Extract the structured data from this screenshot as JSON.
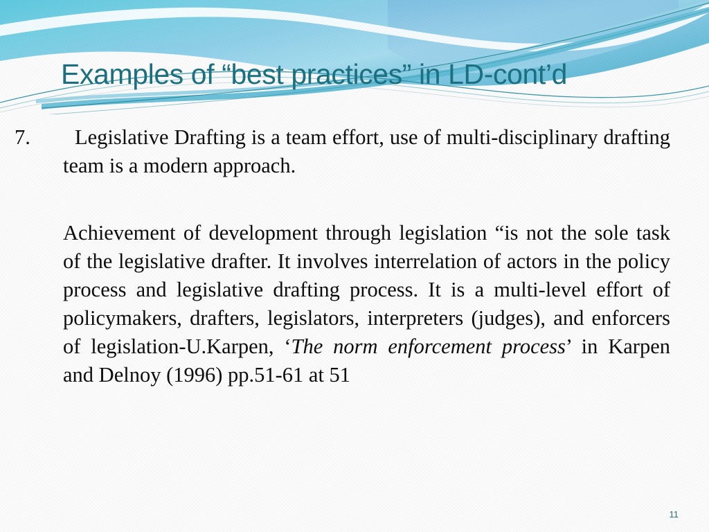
{
  "slide": {
    "title": "Examples of “best practices” in LD-cont’d",
    "page_number": "11",
    "colors": {
      "title_teal": "#1b6f7e",
      "banner_cyan": "#6fc9e0",
      "banner_blue": "#8ec9e8",
      "ribbon_teal": "#3ba8c4",
      "page_number_teal": "#2a6f7c",
      "body_text": "#0d0d0d",
      "background": "#fbfbfb"
    },
    "body": {
      "item_number": "7.",
      "item_text": "Legislative Drafting is a team effort, use of multi-disciplinary drafting team is a modern approach.",
      "quote_part1": "Achievement of development through legislation “is not the sole task of the legislative drafter.  It involves interrelation of actors in the policy process and legislative drafting process. It is a multi-level effort of policymakers, drafters, legislators, interpreters (judges), and enforcers of legislation-U.Karpen, ‘",
      "quote_citation_italic": "The norm enforcement process",
      "quote_part2": "’ in Karpen and Delnoy (1996) pp.51-61 at 51"
    }
  }
}
